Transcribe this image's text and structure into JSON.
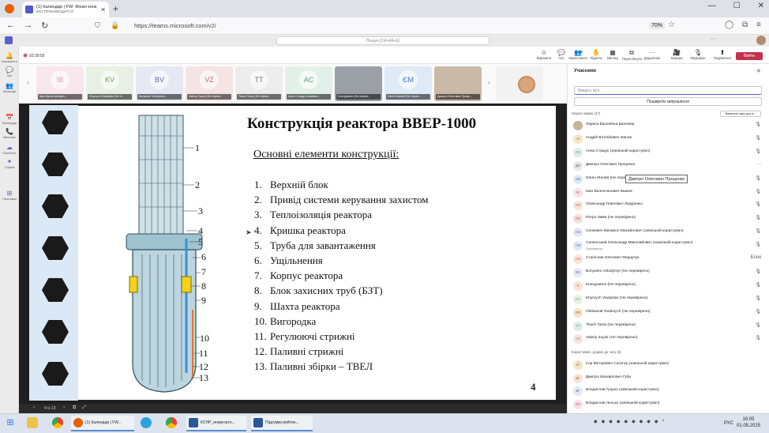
{
  "browser": {
    "tab_title": "(1) Календар | FW: Фінал конк...",
    "tab_subtitle": "ВОСПРОИЗВОДИТСЯ",
    "url": "https://teams.microsoft.com/v2/",
    "zoom": "70%"
  },
  "teams": {
    "search_placeholder": "Пошук (Ctrl+Alt+E)",
    "rail": [
      "Активність",
      "Чат",
      "Команди",
      "Календар",
      "Виклики",
      "OneDrive",
      "Copilot",
      "Програми"
    ],
    "timer": "03:30:55",
    "toolbar": [
      "Виразити",
      "Чат",
      "Користувачі",
      "Підняти",
      "Вигляд",
      "Переглянути",
      "Додатково",
      "Камера",
      "Мікрофон",
      "Поділитися"
    ],
    "participants_count": "18",
    "leave_label": "Вийти"
  },
  "strip": [
    {
      "initials": "IB",
      "name": "Іван Валентинович...",
      "color": "#d9a0b6",
      "bg": "#f7e6ec"
    },
    {
      "initials": "KV",
      "name": "Khymych Vladyslav (Не п...",
      "color": "#6f9b5b",
      "bg": "#e7f0e2"
    },
    {
      "initials": "BV",
      "name": "Boryanko Volodymyr...",
      "color": "#5b6fa6",
      "bg": "#e5e9f3"
    },
    {
      "initials": "VZ",
      "name": "Valeriy Zuyok (Не переві...",
      "color": "#c46a6a",
      "bg": "#f5e4e4"
    },
    {
      "initials": "TT",
      "name": "Tkach Taras (Не переві...",
      "color": "#7a7a7a",
      "bg": "#ececec"
    },
    {
      "initials": "AC",
      "name": "Анна Стащук (зовнішні...",
      "color": "#5f9c7a",
      "bg": "#e3f0e9"
    },
    {
      "initials": "",
      "name": "Energoatom (Не переві...",
      "color": "#555",
      "bg": "#9aa0a6"
    },
    {
      "initials": "ЄМ",
      "name": "Євген Малий (Не перев...",
      "color": "#3a78c3",
      "bg": "#dfeaf7"
    },
    {
      "initials": "",
      "name": "Дмитро Олегович Проце...",
      "color": "#555",
      "bg": "#c9b9a6"
    }
  ],
  "slide": {
    "title": "Конструкція реактора ВВЕР-1000",
    "subtitle": "Основні елементи конструкції:",
    "items": [
      {
        "n": "1.",
        "text": "Верхній блок"
      },
      {
        "n": "2.",
        "text": "Привід системи керування захистом"
      },
      {
        "n": "3.",
        "text": "Теплоізоляція реактора"
      },
      {
        "n": "4.",
        "text": "Кришка реактора"
      },
      {
        "n": "5.",
        "text": "Труба для завантаження"
      },
      {
        "n": "6.",
        "text": "Ущільнення"
      },
      {
        "n": "7.",
        "text": "Корпус реактора"
      },
      {
        "n": "8.",
        "text": "Блок захисних труб (БЗТ)"
      },
      {
        "n": "9.",
        "text": "Шахта реактора"
      },
      {
        "n": "10.",
        "text": "Вигородка"
      },
      {
        "n": "11.",
        "text": "Регулюючі стрижні"
      },
      {
        "n": "12.",
        "text": "Паливні стрижні"
      },
      {
        "n": "13.",
        "text": "Паливні збірки – ТВЕЛ"
      }
    ],
    "callouts": [
      "1",
      "2",
      "3",
      "4",
      "5",
      "6",
      "7",
      "8",
      "9",
      "10",
      "11",
      "12",
      "13"
    ],
    "page": "4",
    "page_control": "4 із 13"
  },
  "panel": {
    "title": "Учасники",
    "search_placeholder": "Введіть ім'я",
    "share_invite": "Поширити запрошення",
    "section_meeting": "Наразі наразі (17)",
    "mute_all": "Вимкнути звук для в...",
    "tooltip": "Дмитро Олегович Проценко",
    "section_waiting": "Користувачі, додані до чату (6)",
    "people": [
      {
        "a": "",
        "name": "Лариса Василівна Шилкова",
        "color": "#8a6e55",
        "bg": "#c9b29a",
        "icon": "🎙"
      },
      {
        "a": "АІ",
        "name": "Андрій Віталійович Іванов",
        "color": "#a06b1f",
        "bg": "#f4e4c9",
        "icon": "🎙"
      },
      {
        "a": "АС",
        "name": "Анна Стащук (зовнішній користувач)",
        "color": "#4b8c6a",
        "bg": "#dceee4",
        "icon": "🎙"
      },
      {
        "a": "ДП",
        "name": "Дмитро Олегович Проценко",
        "color": "#555",
        "bg": "#e8e8e8",
        "icon": "···"
      },
      {
        "a": "ЄМ",
        "name": "Євген Малий (Не пере",
        "color": "#3a78c3",
        "bg": "#dfeaf7",
        "icon": "🎙"
      },
      {
        "a": "ІВ",
        "name": "Іван Валентинович Вашев",
        "color": "#c25a7c",
        "bg": "#f7e1ea",
        "icon": "🎙"
      },
      {
        "a": "ОЛ",
        "name": "Олександр Павлович Лазуренко",
        "color": "#c0653a",
        "bg": "#f8e4d9",
        "icon": "🎙"
      },
      {
        "a": "ПЗ",
        "name": "Петро ЗиВи (Не перевірено)",
        "color": "#b34d4d",
        "bg": "#f5dede",
        "icon": "🎙"
      },
      {
        "a": "СМ",
        "name": "Сенкевич Михайло Михайлович (зовнішній користувач)",
        "color": "#5b6fa6",
        "bg": "#e3e8f4",
        "icon": "🎙"
      },
      {
        "a": "СМ",
        "name": "Синянський Олександр Миколайович (зовнішній користувач)",
        "sub": "Організатор",
        "color": "#5b6fa6",
        "bg": "#e3e8f4",
        "icon": "🎙"
      },
      {
        "a": "СФ",
        "name": "Станіслав Олегович Федорчук",
        "color": "#c0653a",
        "bg": "#f8e4d9",
        "icon": "Блок"
      },
      {
        "a": "BV",
        "name": "Boryanko Volodymyr (Не перевірено)",
        "color": "#5b6fa6",
        "bg": "#e3e8f4",
        "icon": "🎙"
      },
      {
        "a": "E",
        "name": "Energoatom (Не перевірено)",
        "color": "#c0653a",
        "bg": "#f8e4d9",
        "icon": "🎙"
      },
      {
        "a": "KV",
        "name": "Khymych Vladyslav (Не перевірено)",
        "color": "#6f9b5b",
        "bg": "#e7f0e2",
        "icon": "🎙"
      },
      {
        "a": "OR",
        "name": "Oleksandr Rudevych (Не перевірено)",
        "color": "#a06b1f",
        "bg": "#f4e4c9",
        "icon": "🎙"
      },
      {
        "a": "TT",
        "name": "Tkach Taras (Не перевірено)",
        "color": "#4b8c6a",
        "bg": "#dceee4",
        "icon": "🎙"
      },
      {
        "a": "VZ",
        "name": "Valeriy Zuyok (Не перевірено)",
        "color": "#c46a6a",
        "bg": "#f5e4e4",
        "icon": "🎙"
      }
    ],
    "waiting": [
      {
        "a": "ІС",
        "name": "Ігор Вікторович Сагатор (зовнішній користувач)",
        "color": "#a06b1f",
        "bg": "#f4e4c9"
      },
      {
        "a": "ДГ",
        "name": "Дмитро Михайлович Губа",
        "color": "#c0653a",
        "bg": "#f8e4d9"
      },
      {
        "a": "ВГ",
        "name": "Владислав Гуцько (зовнішній користувач)",
        "color": "#5b6fa6",
        "bg": "#e3e8f4"
      },
      {
        "a": "ВЛ",
        "name": "Владислав Лесько (зовнішній користувач)",
        "color": "#c25a7c",
        "bg": "#f7e1ea"
      }
    ]
  },
  "taskbar": {
    "apps": [
      "(1) Календар | FW...",
      "КСНР_енергоато...",
      "Підсумки рейтин..."
    ],
    "lang": "РУС",
    "time": "16:05",
    "date": "01.05.2025"
  }
}
